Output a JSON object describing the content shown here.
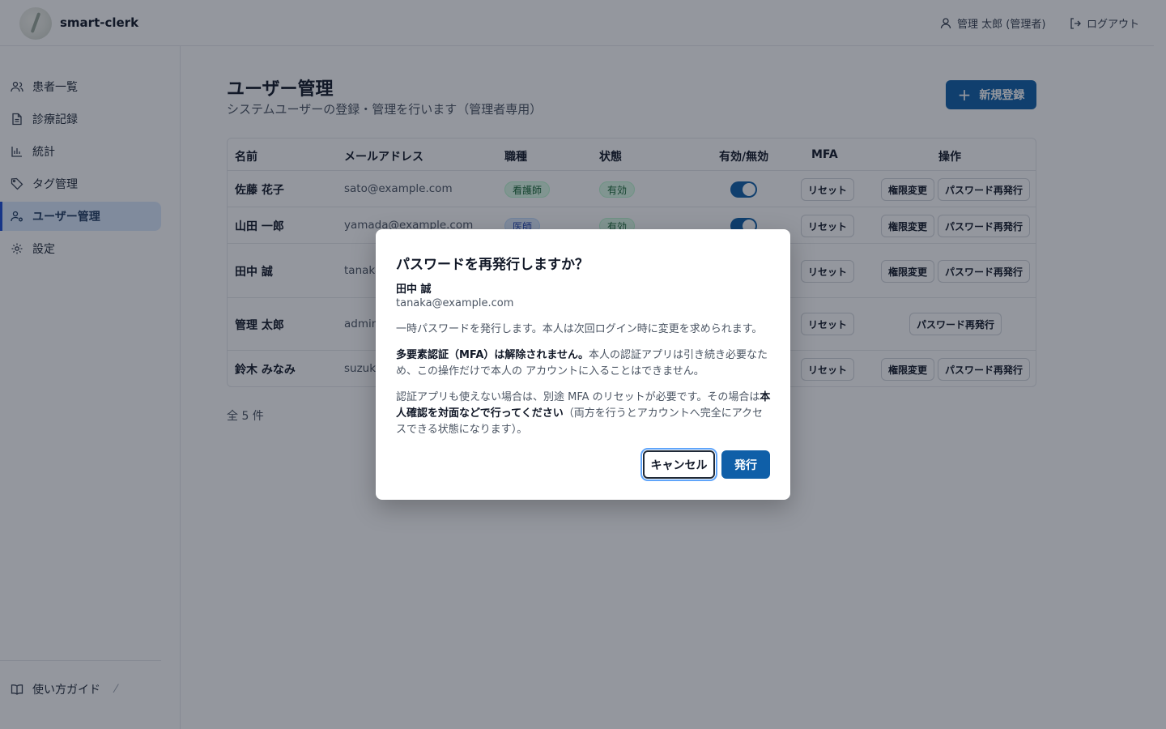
{
  "app": {
    "name": "smart-clerk"
  },
  "header": {
    "user": "管理 太郎 (管理者)",
    "logout": "ログアウト"
  },
  "sidebar": {
    "items": [
      {
        "label": "患者一覧",
        "icon": "users-icon"
      },
      {
        "label": "診療記録",
        "icon": "document-icon"
      },
      {
        "label": "統計",
        "icon": "bar-chart-icon"
      },
      {
        "label": "タグ管理",
        "icon": "tag-icon"
      },
      {
        "label": "ユーザー管理",
        "icon": "user-gear-icon",
        "active": true
      },
      {
        "label": "設定",
        "icon": "gear-icon"
      }
    ],
    "guide": "使い方ガイド"
  },
  "main": {
    "title": "ユーザー管理",
    "subtitle": "システムユーザーの登録・管理を行います（管理者専用）",
    "new_button": "新規登録",
    "columns": [
      "名前",
      "メールアドレス",
      "職種",
      "状態",
      "有効/無効",
      "MFA",
      "操作"
    ],
    "rows": [
      {
        "name": "佐藤 花子",
        "email": "sato@example.com",
        "role": "看護師",
        "status": "有効"
      },
      {
        "name": "山田 一郎",
        "email": "yamada@example.com",
        "role": "医師",
        "status": "有効"
      },
      {
        "name": "田中 誠",
        "email": "tanaka"
      },
      {
        "name": "管理 太郎",
        "email": "admin"
      },
      {
        "name": "鈴木 みなみ",
        "email": "suzuki"
      }
    ],
    "actions": {
      "mfa_reset": "リセット",
      "change_role": "権限変更",
      "reissue_password": "パスワード再発行"
    },
    "total": "全 5 件"
  },
  "dialog": {
    "title": "パスワードを再発行しますか？",
    "user_name": "田中 誠",
    "user_email": "tanaka@example.com",
    "p1": "一時パスワードを発行します。本人は次回ログイン時に変更を求められます。",
    "p2_bold": "多要素認証（MFA）は解除されません。",
    "p2_rest": "本人の認証アプリは引き続き必要なため、この操作だけで本人の アカウントに入ることはできません。",
    "p3_a": "認証アプリも使えない場合は、別途 MFA のリセットが必要です。その場合は",
    "p3_bold": "本人確認を対面などで行ってください",
    "p3_b": "（両方を行うとアカウントへ完全にアクセスできる状態になります）。",
    "cancel": "キャンセル",
    "confirm": "発行"
  },
  "colors": {
    "primary": "#0f5fa8",
    "active_nav_bg": "#dbeafe"
  }
}
